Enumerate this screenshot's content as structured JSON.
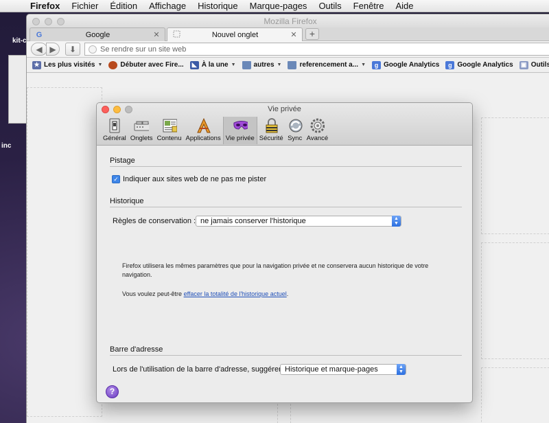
{
  "menubar": {
    "app": "Firefox",
    "items": [
      "Fichier",
      "Édition",
      "Affichage",
      "Historique",
      "Marque-pages",
      "Outils",
      "Fenêtre",
      "Aide"
    ]
  },
  "desktop": {
    "labels": [
      "kit-c",
      "inc"
    ]
  },
  "window": {
    "title": "Mozilla Firefox"
  },
  "tabs": [
    {
      "label": "Google",
      "favicon": "google-icon",
      "active": false
    },
    {
      "label": "Nouvel onglet",
      "favicon": "blank-page-icon",
      "active": true
    }
  ],
  "newtab_label": "+",
  "urlbar": {
    "placeholder": "Se rendre sur un site web"
  },
  "bookmarks": [
    {
      "label": "Les plus visités",
      "icon": "folder-star-icon",
      "menu": true
    },
    {
      "label": "Débuter avec Fire...",
      "icon": "firefox-icon",
      "menu": false
    },
    {
      "label": "À la une",
      "icon": "rss-icon",
      "menu": true
    },
    {
      "label": "autres",
      "icon": "folder-icon",
      "menu": true
    },
    {
      "label": "referencement a...",
      "icon": "folder-icon",
      "menu": true
    },
    {
      "label": "Google Analytics",
      "icon": "google-icon",
      "menu": false
    },
    {
      "label": "Google Analytics",
      "icon": "google-icon",
      "menu": false
    },
    {
      "label": "Outils pour les",
      "icon": "tool-icon",
      "menu": false
    }
  ],
  "prefs": {
    "title": "Vie privée",
    "toolbar": [
      {
        "label": "Général",
        "icon": "switch-icon"
      },
      {
        "label": "Onglets",
        "icon": "tabs-icon"
      },
      {
        "label": "Contenu",
        "icon": "content-icon"
      },
      {
        "label": "Applications",
        "icon": "applications-icon"
      },
      {
        "label": "Vie privée",
        "icon": "mask-icon",
        "selected": true
      },
      {
        "label": "Sécurité",
        "icon": "lock-icon"
      },
      {
        "label": "Sync",
        "icon": "sync-icon"
      },
      {
        "label": "Avancé",
        "icon": "gear-icon"
      }
    ],
    "tracking": {
      "heading": "Pistage",
      "do_not_track_label": "Indiquer aux sites web de ne pas me pister",
      "do_not_track_checked": true
    },
    "history": {
      "heading": "Historique",
      "rules_label": "Règles de conservation :",
      "rules_value": "ne jamais conserver l'historique",
      "info": "Firefox utilisera les mêmes paramètres que pour la navigation privée et ne conservera aucun historique de votre navigation.",
      "clear_prefix": "Vous voulez peut-être ",
      "clear_link": "effacer la totalité de l'historique actuel",
      "clear_suffix": "."
    },
    "addressbar": {
      "heading": "Barre d'adresse",
      "suggest_label": "Lors de l'utilisation de la barre d'adresse, suggérer :",
      "suggest_value": "Historique et marque-pages"
    },
    "help_label": "?"
  },
  "colors": {
    "accent": "#3f86e8",
    "link": "#1f4fb8",
    "close": "#fc605c",
    "minimize": "#fdbc40"
  }
}
